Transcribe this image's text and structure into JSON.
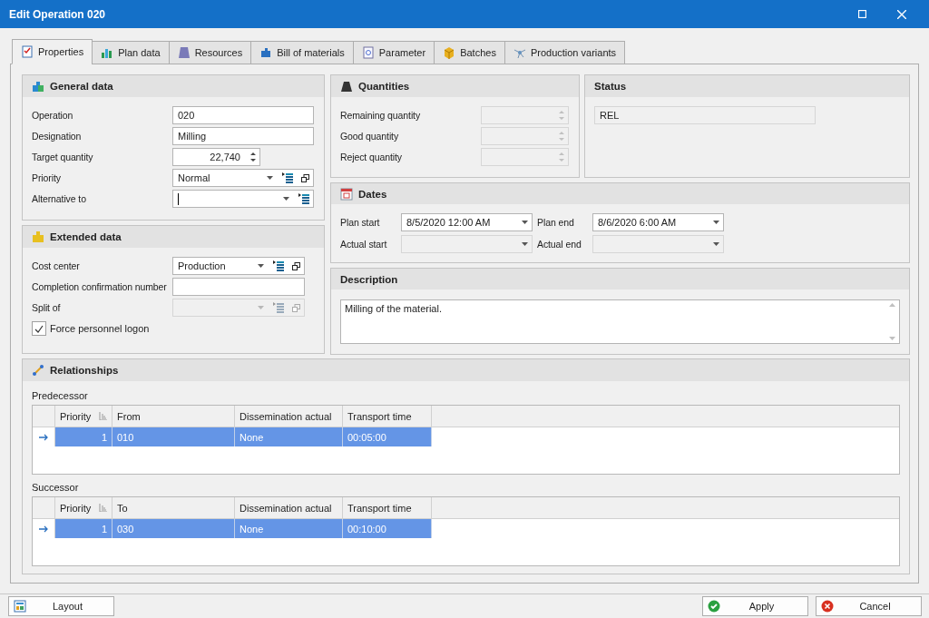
{
  "window": {
    "title": "Edit Operation 020"
  },
  "tabs": [
    {
      "label": "Properties",
      "selected": true
    },
    {
      "label": "Plan data",
      "selected": false
    },
    {
      "label": "Resources",
      "selected": false
    },
    {
      "label": "Bill of materials",
      "selected": false
    },
    {
      "label": "Parameter",
      "selected": false
    },
    {
      "label": "Batches",
      "selected": false
    },
    {
      "label": "Production variants",
      "selected": false
    }
  ],
  "general_data": {
    "title": "General data",
    "fields": [
      {
        "label": "Operation",
        "kind": "text",
        "value": "020",
        "disabled": false
      },
      {
        "label": "Designation",
        "kind": "text",
        "value": "Milling",
        "disabled": false
      },
      {
        "label": "Target quantity",
        "kind": "spin",
        "value": "22,740",
        "disabled": false
      },
      {
        "label": "Priority",
        "kind": "combo",
        "value": "Normal",
        "disabled": false
      },
      {
        "label": "Alternative to",
        "kind": "lookup",
        "focused": true,
        "disabled": false
      }
    ]
  },
  "extended_data": {
    "title": "Extended data",
    "fields": [
      {
        "label": "Cost center",
        "kind": "combo",
        "value": "Production",
        "disabled": false
      },
      {
        "label": "Completion confirmation number",
        "kind": "text",
        "disabled": false
      },
      {
        "label": "Split of",
        "kind": "combo",
        "disabled": true
      }
    ],
    "checkbox": {
      "label": "Force personnel logon",
      "checked": true
    }
  },
  "quantities": {
    "title": "Quantities",
    "fields": [
      {
        "label": "Remaining quantity",
        "kind": "spin",
        "disabled": true
      },
      {
        "label": "Good quantity",
        "kind": "spin",
        "disabled": true
      },
      {
        "label": "Reject quantity",
        "kind": "spin",
        "disabled": true
      }
    ]
  },
  "status": {
    "title": "Status",
    "value": "REL"
  },
  "dates": {
    "title": "Dates",
    "fields": [
      {
        "label": "Plan start",
        "value": "8/5/2020 12:00 AM",
        "disabled": false
      },
      {
        "label": "Plan end",
        "value": "8/6/2020 6:00 AM",
        "disabled": false
      },
      {
        "label": "Actual start",
        "disabled": true
      },
      {
        "label": "Actual end",
        "disabled": true
      }
    ]
  },
  "description": {
    "title": "Description",
    "value": "Milling of the material."
  },
  "relationships": {
    "title": "Relationships",
    "grids": [
      {
        "label": "Predecessor",
        "columns": [
          "Priority",
          "From",
          "Dissemination actual",
          "Transport time"
        ],
        "rows": [
          {
            "cells": [
              "1",
              "010",
              "None",
              "00:05:00"
            ],
            "selected": true
          }
        ]
      },
      {
        "label": "Successor",
        "columns": [
          "Priority",
          "To",
          "Dissemination actual",
          "Transport time"
        ],
        "rows": [
          {
            "cells": [
              "1",
              "030",
              "None",
              "00:10:00"
            ],
            "selected": true
          }
        ]
      }
    ]
  },
  "buttons": [
    {
      "label": "Layout",
      "kind": "layout"
    },
    {
      "label": "Apply",
      "kind": "apply"
    },
    {
      "label": "Cancel",
      "kind": "cancel"
    }
  ]
}
